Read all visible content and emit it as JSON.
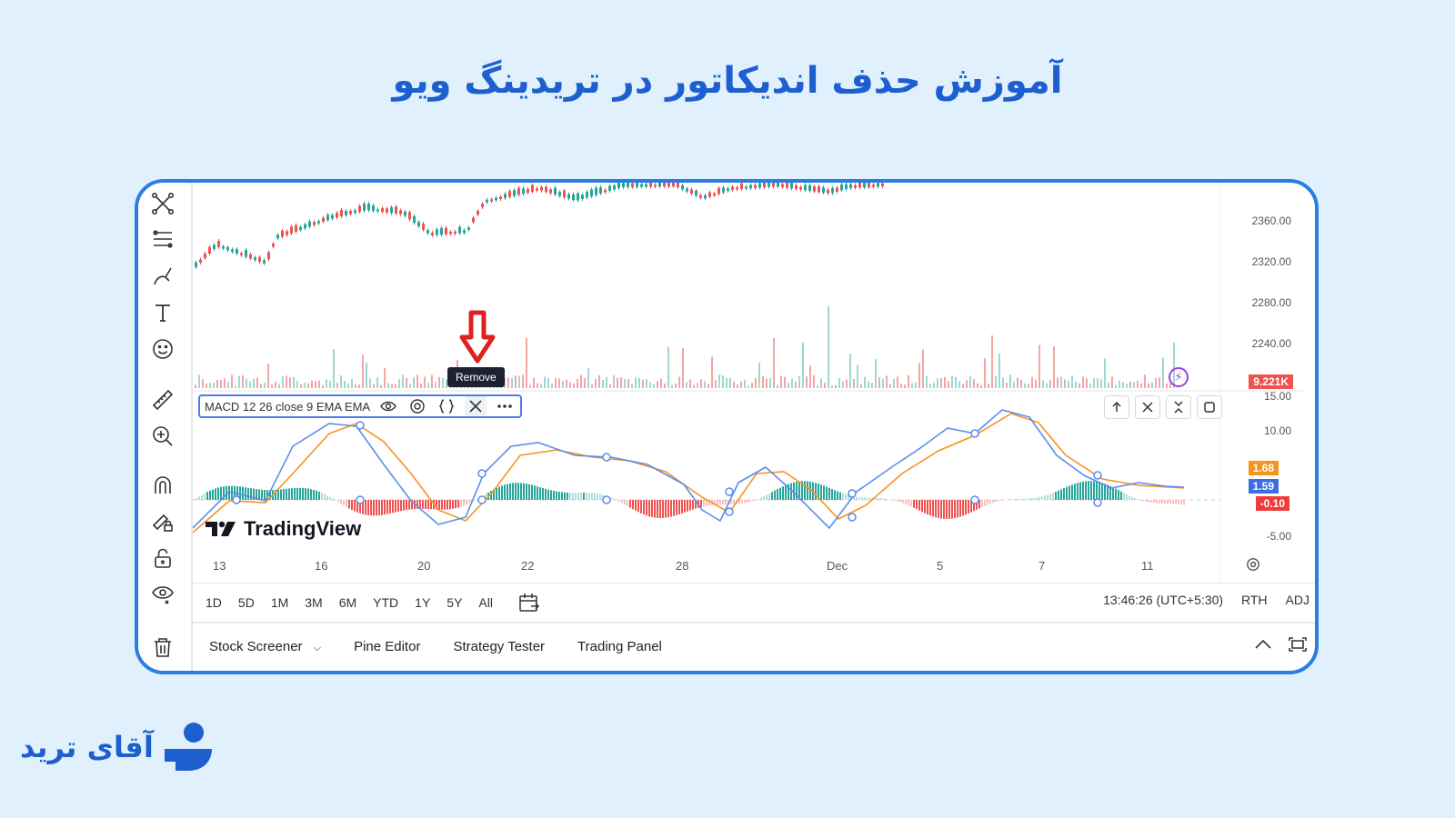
{
  "headline": "آموزش حذف اندیکاتور در تریدینگ ویو",
  "logo_text": "آقای ترید",
  "price_axis": [
    "2360.00",
    "2320.00",
    "2280.00",
    "2240.00"
  ],
  "volume_tag": "9.221K",
  "macd_axis": [
    "15.00",
    "10.00",
    "-5.00"
  ],
  "macd_tags": {
    "orange": "1.68",
    "blue": "1.59",
    "red": "-0.10"
  },
  "legend": {
    "label": "MACD 12 26 close 9 EMA EMA"
  },
  "tooltip": "Remove",
  "watermark": "TradingView",
  "time_labels": [
    "13",
    "16",
    "20",
    "22",
    "28",
    "Dec",
    "5",
    "7",
    "11"
  ],
  "ranges": [
    "1D",
    "5D",
    "1M",
    "3M",
    "6M",
    "YTD",
    "1Y",
    "5Y",
    "All"
  ],
  "clock": "13:46:26 (UTC+5:30)",
  "session": "RTH",
  "adj": "ADJ",
  "bottom_tabs": [
    "Stock Screener",
    "Pine Editor",
    "Strategy Tester",
    "Trading Panel"
  ],
  "colors": {
    "accent": "#2a7de3",
    "up": "#26a69a",
    "down": "#ef5350",
    "macd_line": "#5b8def",
    "signal_line": "#f7931e",
    "arrow": "#e02020"
  }
}
